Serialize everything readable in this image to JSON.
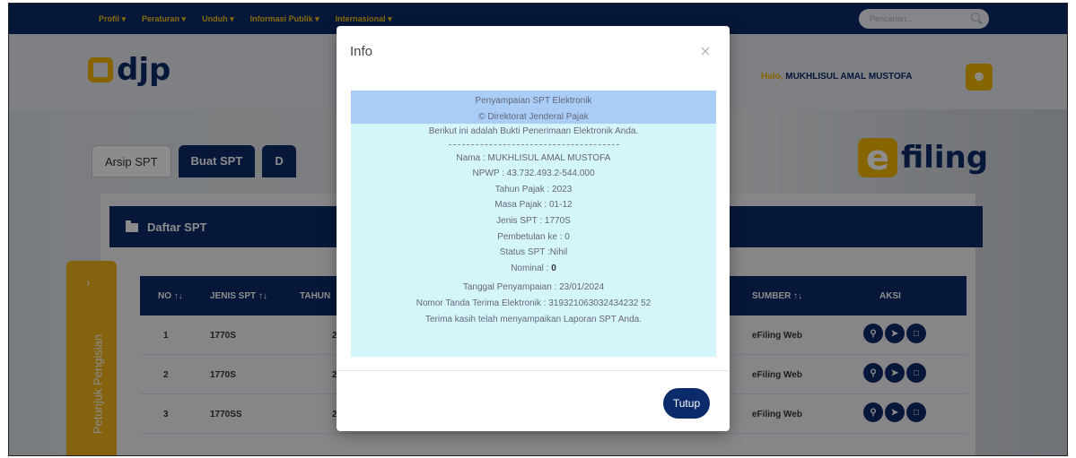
{
  "nav": {
    "items": [
      "Profil ▾",
      "Peraturan ▾",
      "Unduh ▾",
      "Informasi Publik ▾",
      "Internasional ▾"
    ],
    "search_placeholder": "Pencarian..."
  },
  "header": {
    "logo_text": "djp",
    "greeting": "Halo,",
    "user_name": "MUKHLISUL AMAL MUSTOFA"
  },
  "brand": {
    "efiling_e": "e",
    "efiling_rest": "filing"
  },
  "tabs": [
    "Arsip SPT",
    "Buat SPT",
    "D"
  ],
  "panel": {
    "title": "Daftar SPT"
  },
  "table": {
    "headers": [
      "NO ↑↓",
      "JENIS SPT ↑↓",
      "TAHUN",
      "SUMBER ↑↓",
      "AKSI"
    ],
    "rows": [
      {
        "no": "1",
        "jenis": "1770S",
        "tahun_fragment": "2",
        "sumber": "eFiling Web"
      },
      {
        "no": "2",
        "jenis": "1770S",
        "tahun_fragment": "2",
        "sumber": "eFiling Web"
      },
      {
        "no": "3",
        "jenis": "1770SS",
        "tahun_fragment": "2",
        "sumber": "eFiling Web"
      }
    ]
  },
  "side_tab": {
    "chevron": "›",
    "label": "Petunjuk Pengisian"
  },
  "modal": {
    "title": "Info",
    "close": "×",
    "receipt": {
      "header_line1": "Penyampaian SPT Elektronik",
      "header_line2": "© Direktorat Jenderal Pajak",
      "intro": "Berikut ini adalah Bukti Penerimaan Elektronik Anda.",
      "nama": "Nama : MUKHLISUL AMAL MUSTOFA",
      "npwp": "NPWP : 43.732.493.2-544.000",
      "tahun_pajak": "Tahun Pajak : 2023",
      "masa_pajak": "Masa Pajak : 01-12",
      "jenis_spt": "Jenis SPT : 1770S",
      "pembetulan": "Pembetulan ke : 0",
      "status": "Status SPT :Nihil",
      "nominal_label": "Nominal : ",
      "nominal_value": "0",
      "tanggal": "Tanggal Penyampaian : 23/01/2024",
      "ntte": "Nomor Tanda Terima Elektronik : 319321063032434232 52",
      "thanks": "Terima kasih telah menyampaikan Laporan SPT Anda."
    },
    "button_label": "Tutup"
  },
  "colors": {
    "navy": "#0b2b6b",
    "accent": "#f5b800",
    "receipt_bg": "#d4f6fb",
    "receipt_header": "#a9cdf6"
  }
}
